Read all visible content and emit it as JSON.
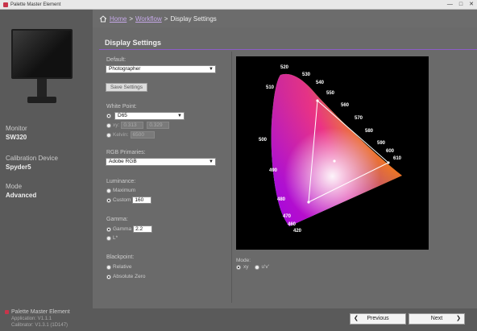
{
  "window": {
    "title": "Palette Master Element",
    "controls": [
      "—",
      "□",
      "✕"
    ]
  },
  "sidebar": {
    "monitor_label": "Monitor",
    "monitor_value": "SW320",
    "device_label": "Calibration Device",
    "device_value": "Spyder5",
    "mode_label": "Mode",
    "mode_value": "Advanced",
    "footer_brand": "Palette Master Element",
    "footer_app": "Application: V1.1.1",
    "footer_calibrator": "Calibrator: V1.3.1 (1D147)"
  },
  "breadcrumb": {
    "home": "Home",
    "sep1": ">",
    "workflow": "Workflow",
    "sep2": ">",
    "current": "Display Settings"
  },
  "main": {
    "title": "Display Settings",
    "default_label": "Default:",
    "default_value": "Photographer",
    "save_button": "Save Settings",
    "white_point_label": "White Point:",
    "wp_option_d65": "D65",
    "wp_xy_label": "xy:",
    "wp_x": "0.313",
    "wp_y": "0.329",
    "wp_kelvin_label": "Kelvin:",
    "wp_kelvin_value": "6500",
    "rgb_label": "RGB Primaries:",
    "rgb_value": "Adobe RGB",
    "luminance_label": "Luminance:",
    "lum_max": "Maximum",
    "lum_custom": "Custom",
    "lum_custom_value": "160",
    "gamma_label": "Gamma:",
    "gamma_option": "Gamma",
    "gamma_value": "2.2",
    "gamma_lstar": "L*",
    "blackpoint_label": "Blackpoint:",
    "bp_relative": "Relative",
    "bp_absolute": "Absolute Zero",
    "mode_label": "Mode:",
    "mode_xy": "xy",
    "mode_uv": "u'v'"
  },
  "gamut_labels": [
    "520",
    "530",
    "540",
    "510",
    "550",
    "560",
    "570",
    "580",
    "590",
    "600",
    "610",
    "500",
    "490",
    "480",
    "470",
    "460",
    "420"
  ],
  "nav": {
    "previous": "Previous",
    "next": "Next",
    "prev_icon": "chevron-left-icon",
    "next_icon": "chevron-right-icon"
  },
  "colors": {
    "accent": "#8c5cc8",
    "link": "#c5a8e8",
    "brand": "#c8344a"
  }
}
